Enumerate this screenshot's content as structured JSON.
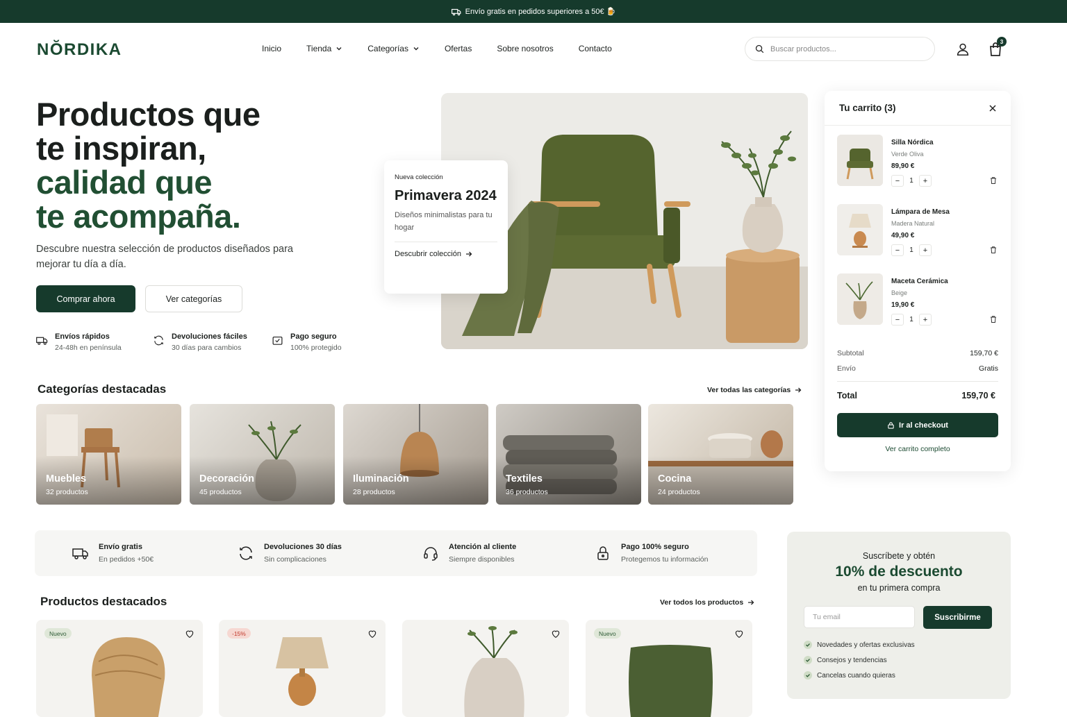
{
  "announcement": {
    "text": "Envío gratis en pedidos superiores a 50€ 🍺"
  },
  "brand": {
    "logo": "NŎRDIKA",
    "primary": "#163a2c",
    "accent": "#214f33"
  },
  "nav": {
    "items": [
      {
        "label": "Inicio",
        "dropdown": false
      },
      {
        "label": "Tienda",
        "dropdown": true
      },
      {
        "label": "Categorías",
        "dropdown": true
      },
      {
        "label": "Ofertas",
        "dropdown": false
      },
      {
        "label": "Sobre nosotros",
        "dropdown": false
      },
      {
        "label": "Contacto",
        "dropdown": false
      }
    ]
  },
  "search": {
    "placeholder": "Buscar productos..."
  },
  "header": {
    "cart_count": "3"
  },
  "hero": {
    "title_lines": [
      "Productos que",
      "te inspiran,",
      "calidad que",
      "te acompaña."
    ],
    "subtitle": "Descubre nuestra selección de productos diseñados para mejorar tu día a día.",
    "primary_btn": "Comprar ahora",
    "secondary_btn": "Ver categorías",
    "features": [
      {
        "title": "Envíos rápidos",
        "sub": "24-48h en península",
        "icon": "truck-icon"
      },
      {
        "title": "Devoluciones fáciles",
        "sub": "30 días para cambios",
        "icon": "refresh-icon"
      },
      {
        "title": "Pago seguro",
        "sub": "100% protegido",
        "icon": "secure-payment-icon"
      }
    ]
  },
  "promo": {
    "kicker": "Nueva colección",
    "title": "Primavera 2024",
    "desc": "Diseños minimalistas para tu hogar",
    "link": "Descubrir colección"
  },
  "cart": {
    "title": "Tu carrito (3)",
    "items": [
      {
        "name": "Silla Nórdica",
        "variant": "Verde Oliva",
        "price": "89,90 €",
        "qty": "1"
      },
      {
        "name": "Lámpara de Mesa",
        "variant": "Madera Natural",
        "price": "49,90 €",
        "qty": "1"
      },
      {
        "name": "Maceta Cerámica",
        "variant": "Beige",
        "price": "19,90 €",
        "qty": "1"
      }
    ],
    "subtotal_label": "Subtotal",
    "subtotal": "159,70 €",
    "shipping_label": "Envío",
    "shipping": "Gratis",
    "total_label": "Total",
    "total": "159,70 €",
    "checkout": "Ir al checkout",
    "view": "Ver carrito completo"
  },
  "categories": {
    "title": "Categorías destacadas",
    "link": "Ver todas las categorías",
    "items": [
      {
        "name": "Muebles",
        "count": "32 productos"
      },
      {
        "name": "Decoración",
        "count": "45 productos"
      },
      {
        "name": "Iluminación",
        "count": "28 productos"
      },
      {
        "name": "Textiles",
        "count": "36 productos"
      },
      {
        "name": "Cocina",
        "count": "24 productos"
      }
    ]
  },
  "benefits": [
    {
      "title": "Envío gratis",
      "sub": "En pedidos +50€",
      "icon": "truck-icon"
    },
    {
      "title": "Devoluciones 30 días",
      "sub": "Sin complicaciones",
      "icon": "refresh-icon"
    },
    {
      "title": "Atención al cliente",
      "sub": "Siempre disponibles",
      "icon": "headset-icon"
    },
    {
      "title": "Pago 100% seguro",
      "sub": "Protegemos tu información",
      "icon": "lock-icon"
    }
  ],
  "products": {
    "title": "Productos destacados",
    "link": "Ver todos los productos",
    "badges": [
      "Nuevo",
      "-15%",
      "",
      "Nuevo"
    ]
  },
  "newsletter": {
    "line1": "Suscríbete y obtén",
    "line2": "10% de descuento",
    "line3": "en tu primera compra",
    "placeholder": "Tu email",
    "button": "Suscribirme",
    "perks": [
      "Novedades y ofertas exclusivas",
      "Consejos y tendencias",
      "Cancelas cuando quieras"
    ]
  }
}
